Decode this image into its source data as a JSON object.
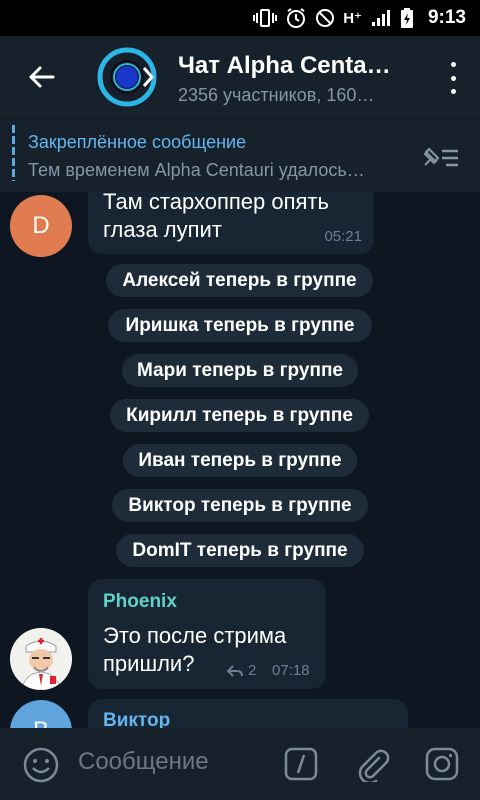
{
  "status": {
    "network": "H⁺",
    "time": "9:13"
  },
  "header": {
    "title": "Чат Alpha Centa…",
    "subtitle": "2356 участников, 160…"
  },
  "pinned": {
    "title": "Закреплённое сообщение",
    "text": "Тем временем Alpha Centauri удалось…"
  },
  "messages": {
    "first": {
      "avatar_letter": "D",
      "text": "Там стархоппер опять глаза лупит",
      "time": "05:21"
    },
    "phoenix": {
      "sender": "Phoenix",
      "text": "Это после стрима пришли?",
      "replies": "2",
      "time": "07:18"
    },
    "viktor": {
      "sender": "Виктор",
      "avatar_letter": "В"
    }
  },
  "service": [
    "Алексей теперь в группе",
    "Иришка теперь в группе",
    "Мари теперь в группе",
    "Кирилл теперь в группе",
    "Иван теперь в группе",
    "Виктор теперь в группе",
    "DomIT теперь в группе"
  ],
  "input": {
    "placeholder": "Сообщение"
  },
  "colors": {
    "background": "#0e1621",
    "panel": "#17212b",
    "bubble": "#182533",
    "accent": "#64b5ef",
    "phoenix_name": "#5fd3c9",
    "avatar_d": "#e07c4f",
    "avatar_v": "#5fa4dc"
  }
}
